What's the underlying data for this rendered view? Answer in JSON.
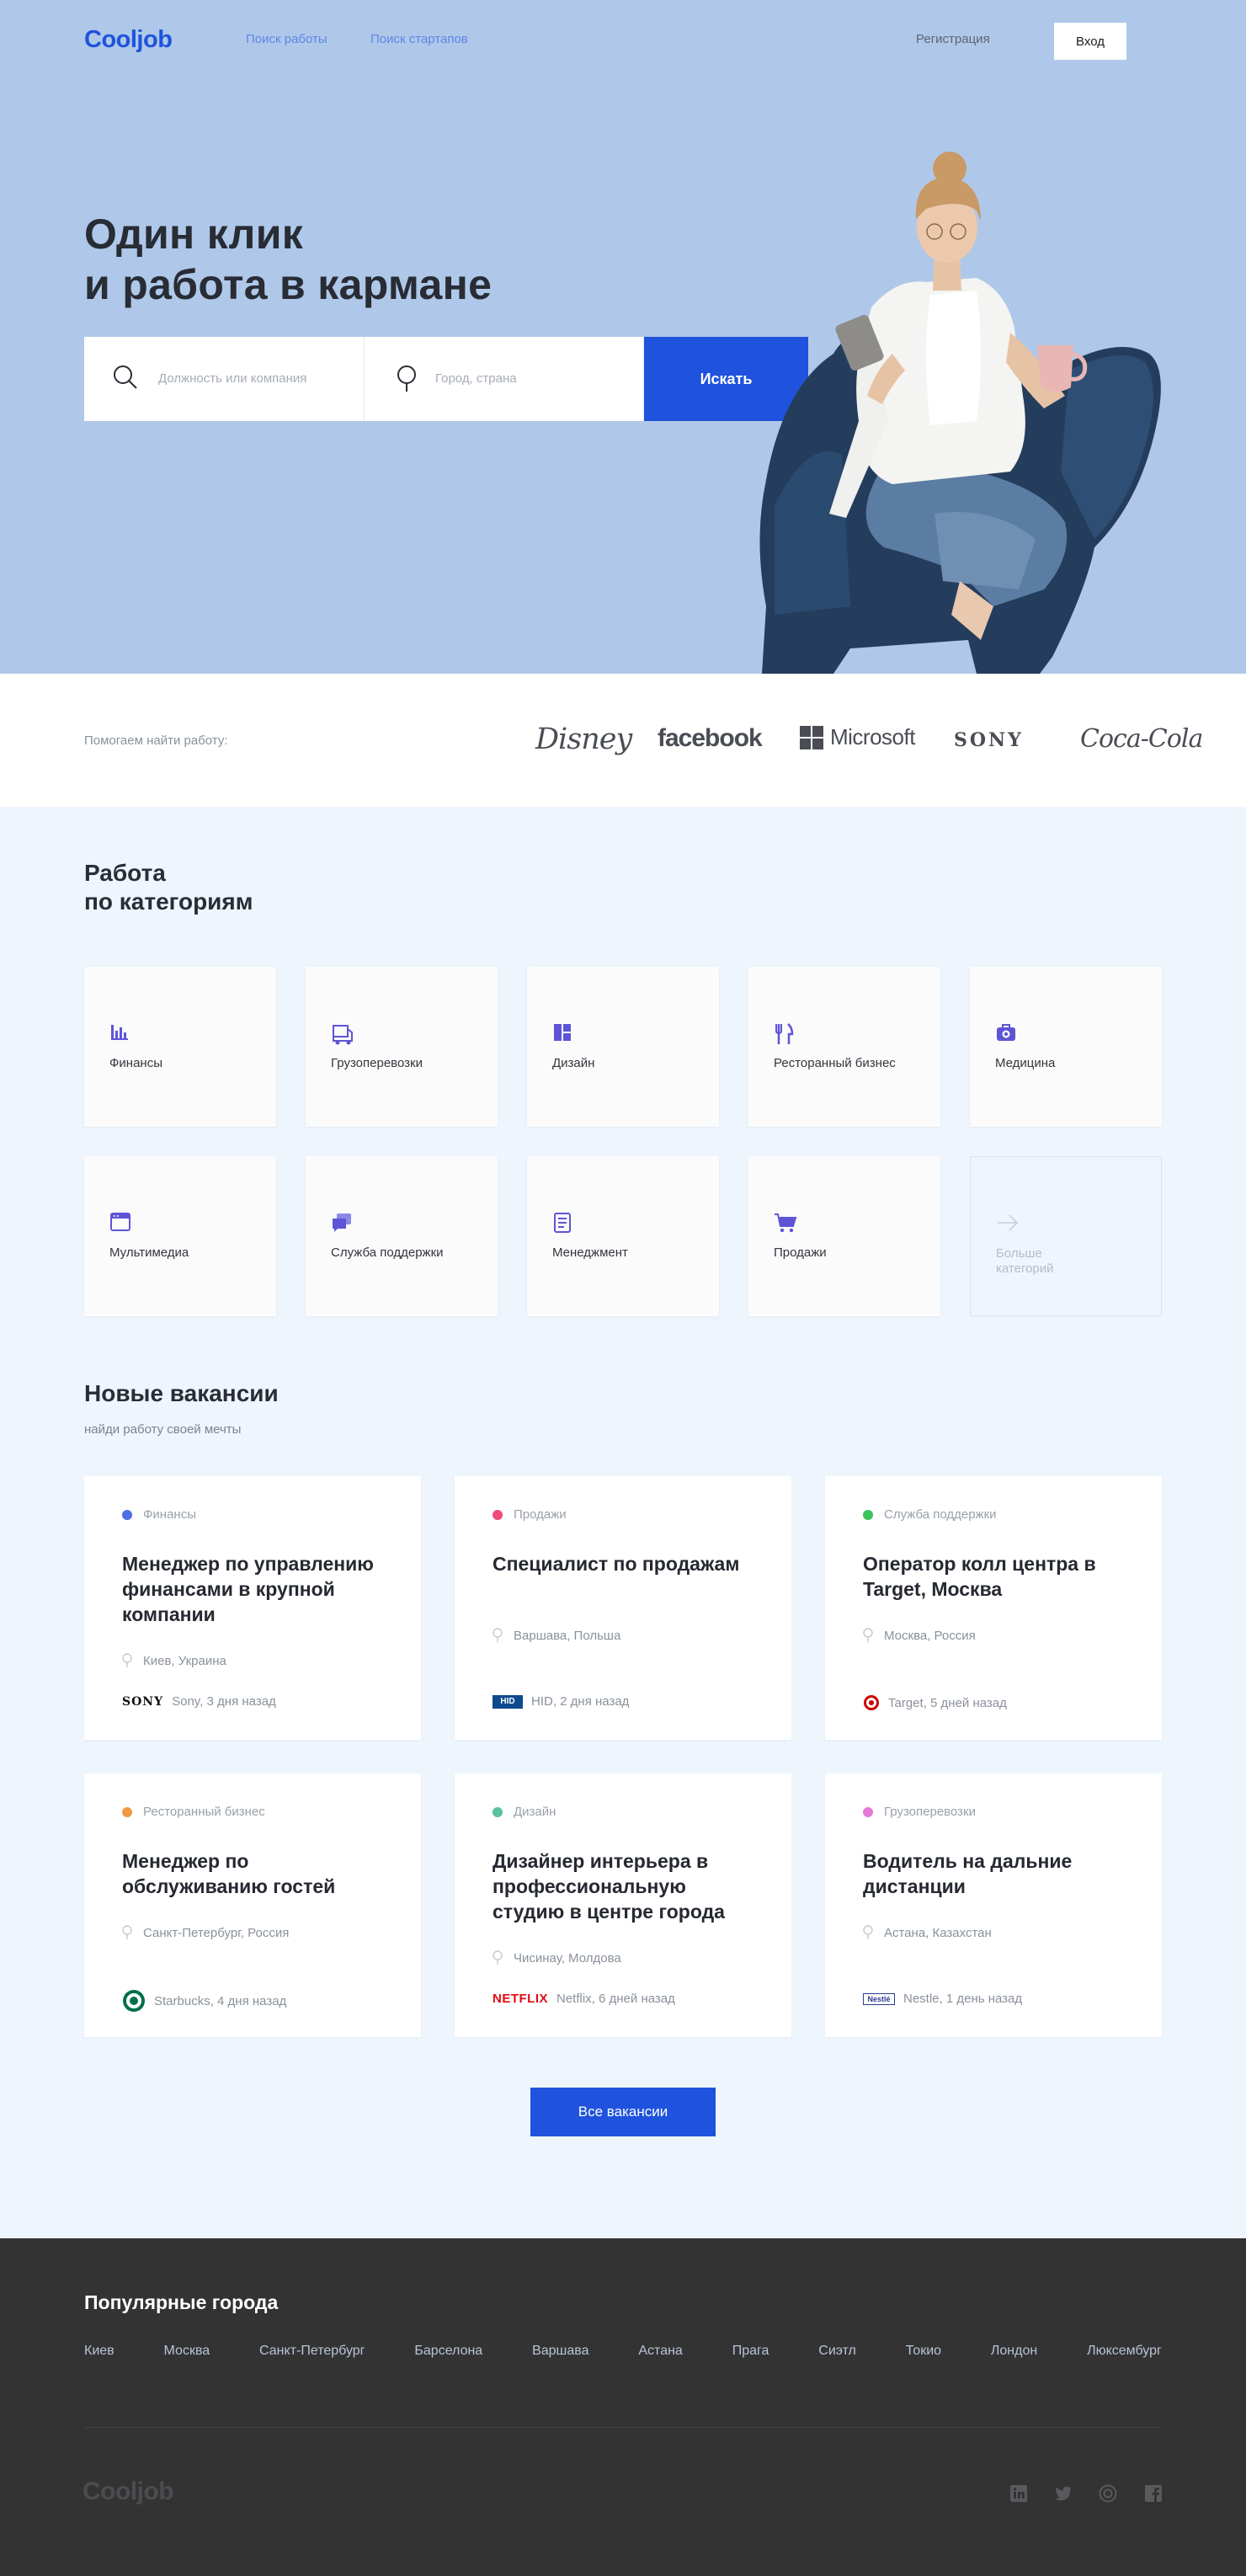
{
  "header": {
    "logo": "Cooljob",
    "nav": [
      "Поиск работы",
      "Поиск стартапов"
    ],
    "register": "Регистрация",
    "login": "Вход"
  },
  "hero": {
    "title_line1": "Один клик",
    "title_line2": "и работа в кармане",
    "search_placeholder": "Должность или компания",
    "city_placeholder": "Город, страна",
    "search_button": "Искать"
  },
  "partners": {
    "label": "Помогаем найти работу:",
    "brands": [
      "Disney",
      "facebook",
      "Microsoft",
      "SONY",
      "Coca-Cola"
    ]
  },
  "categories": {
    "title_line1": "Работа",
    "title_line2": "по категориям",
    "items": [
      {
        "label": "Финансы",
        "icon": "chart-icon"
      },
      {
        "label": "Грузоперевозки",
        "icon": "truck-icon"
      },
      {
        "label": "Дизайн",
        "icon": "layout-icon"
      },
      {
        "label": "Ресторанный бизнес",
        "icon": "fork-knife-icon"
      },
      {
        "label": "Медицина",
        "icon": "medical-bag-icon"
      },
      {
        "label": "Мультимедиа",
        "icon": "media-window-icon"
      },
      {
        "label": "Служба поддержки",
        "icon": "chat-icon"
      },
      {
        "label": "Менеджмент",
        "icon": "document-icon"
      },
      {
        "label": "Продажи",
        "icon": "cart-icon"
      },
      {
        "label": "Больше категорий",
        "icon": "arrow-right-icon"
      }
    ]
  },
  "vacancies": {
    "title": "Новые вакансии",
    "subtitle": "найди работу своей мечты",
    "items": [
      {
        "category": "Финансы",
        "color": "#4f6ee6",
        "title": "Менеджер по управлению финансами в крупной компании",
        "location": "Киев, Украина",
        "company": "Sony, 3 дня назад",
        "logo": "SONY"
      },
      {
        "category": "Продажи",
        "color": "#ee4a7c",
        "title": "Специалист по продажам",
        "location": "Варшава, Польша",
        "company": "HID, 2 дня назад",
        "logo": "HID"
      },
      {
        "category": "Служба поддержки",
        "color": "#3bc45b",
        "title": "Оператор колл центра в Target, Москва",
        "location": "Москва, Россия",
        "company": "Target, 5 дней назад",
        "logo": "target"
      },
      {
        "category": "Ресторанный бизнес",
        "color": "#ef9a42",
        "title": "Менеджер по обслуживанию гостей",
        "location": "Санкт-Петербург, Россия",
        "company": "Starbucks, 4 дня назад",
        "logo": "starbucks"
      },
      {
        "category": "Дизайн",
        "color": "#5ac0a0",
        "title": "Дизайнер интерьера в профессиональную студию в центре города",
        "location": "Чисинау, Молдова",
        "company": "Netflix, 6 дней назад",
        "logo": "NETFLIX"
      },
      {
        "category": "Грузоперевозки",
        "color": "#e47ad6",
        "title": "Водитель на дальние дистанции",
        "location": "Астана, Казахстан",
        "company": "Nestle, 1 день назад",
        "logo": "Nestlé"
      }
    ],
    "all_button": "Все вакансии"
  },
  "footer": {
    "title": "Популярные города",
    "cities": [
      "Киев",
      "Москва",
      "Санкт-Петербург",
      "Барселона",
      "Варшава",
      "Астана",
      "Прага",
      "Сиэтл",
      "Токио",
      "Лондон",
      "Люксембург"
    ],
    "logo": "Cooljob",
    "social": [
      "linkedin-icon",
      "twitter-icon",
      "instagram-icon",
      "facebook-icon"
    ]
  }
}
